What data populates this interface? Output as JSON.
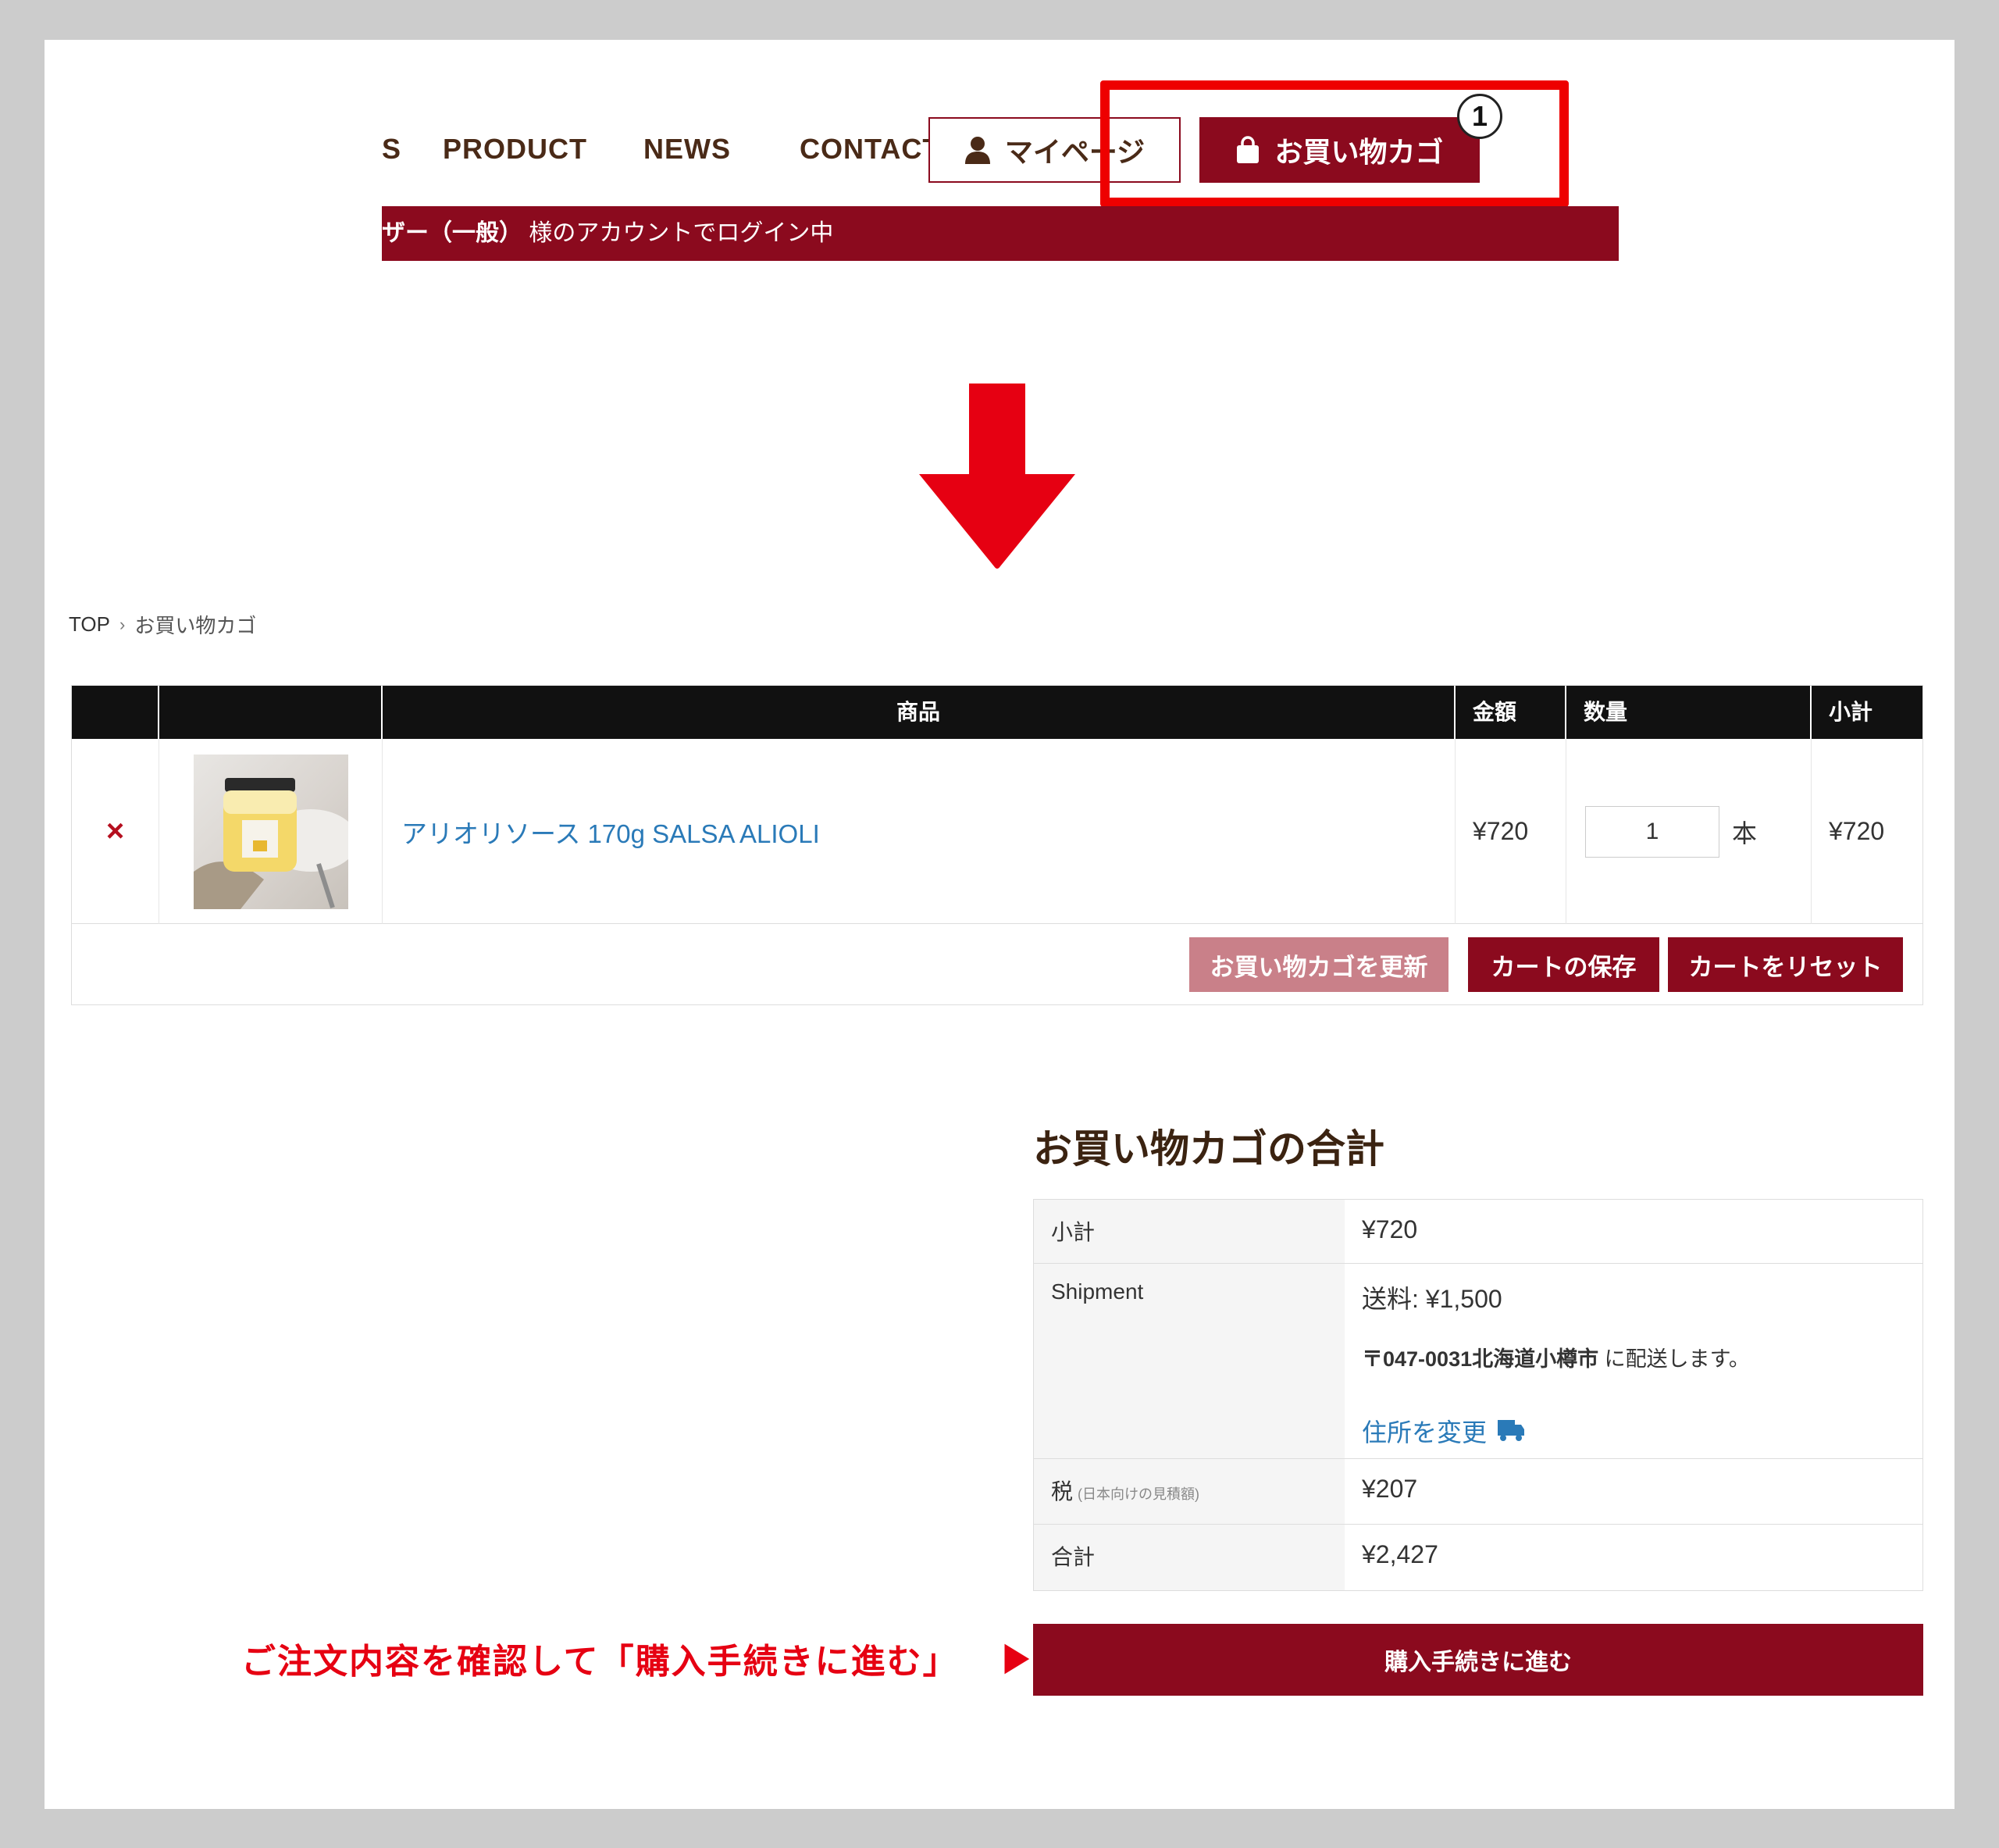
{
  "nav": {
    "items": [
      "S",
      "PRODUCT",
      "NEWS",
      "CONTACT"
    ],
    "mypage_label": "マイページ",
    "cart_label": "お買い物カゴ",
    "cart_count": "1"
  },
  "login_bar": {
    "user_text": "ザー（一般）",
    "suffix_text": "様のアカウントでログイン中"
  },
  "breadcrumb": {
    "home": "TOP",
    "separator": "›",
    "current": "お買い物カゴ"
  },
  "cart": {
    "headers": {
      "product": "商品",
      "price": "金額",
      "quantity": "数量",
      "subtotal": "小計"
    },
    "rows": [
      {
        "remove": "×",
        "name": "アリオリソース 170g SALSA ALIOLI",
        "price": "¥720",
        "qty": "1",
        "unit": "本",
        "subtotal": "¥720"
      }
    ],
    "actions": {
      "update": "お買い物カゴを更新",
      "save": "カートの保存",
      "reset": "カートをリセット"
    }
  },
  "totals": {
    "title": "お買い物カゴの合計",
    "subtotal_label": "小計",
    "subtotal_value": "¥720",
    "shipment_label": "Shipment",
    "shipment_fee": "送料: ¥1,500",
    "shipment_dest_bold": "〒047-0031北海道小樽市",
    "shipment_dest_suffix": " に配送します。",
    "change_address": "住所を変更",
    "tax_label": "税",
    "tax_note": "(日本向けの見積額)",
    "tax_value": "¥207",
    "total_label": "合計",
    "total_value": "¥2,427"
  },
  "checkout": {
    "instruction": "ご注文内容を確認して「購入手続きに進む」",
    "button": "購入手続きに進む"
  },
  "colors": {
    "brand": "#8b0a1e",
    "annotation_red": "#e60012",
    "link_blue": "#2a7ab8"
  },
  "icons": [
    "user-icon",
    "shopping-bag-icon",
    "down-arrow-icon",
    "truck-icon",
    "pointer-triangle-icon",
    "remove-icon"
  ]
}
